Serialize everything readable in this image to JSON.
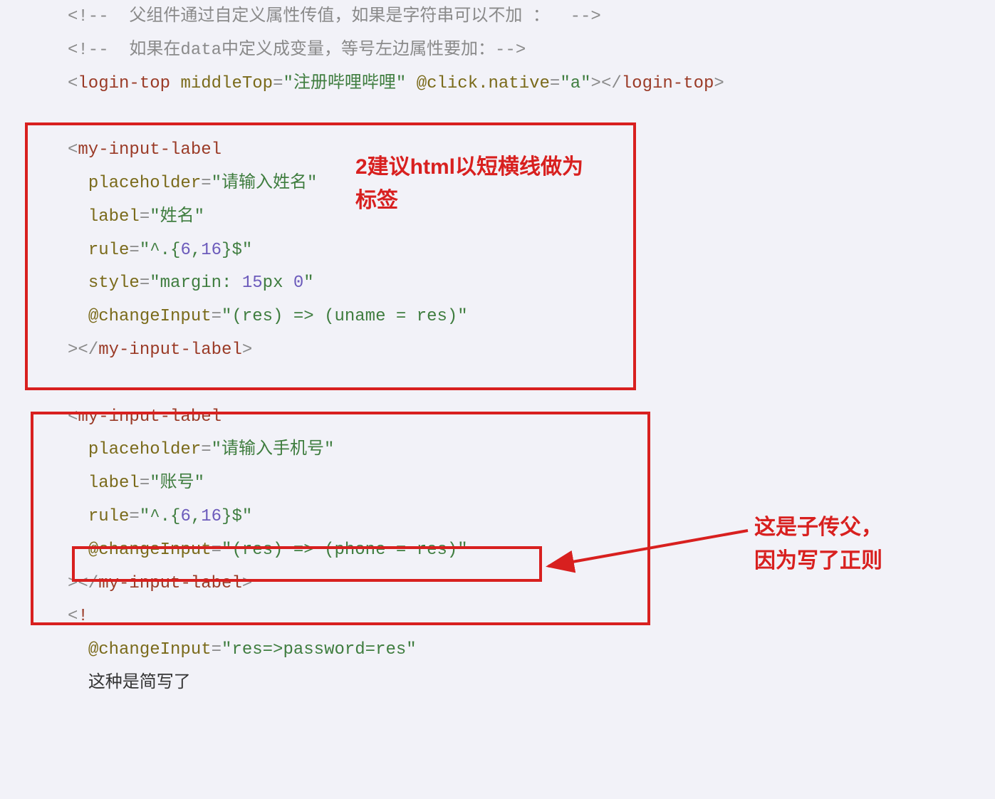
{
  "code": {
    "comment1_open": "<!--",
    "comment1_text": "  父组件通过自定义属性传值，如果是字符串可以不加 ：  ",
    "comment1_close": "-->",
    "comment2_open": "<!--",
    "comment2_text": "  如果在data中定义成变量，等号左边属性要加：",
    "comment2_close": "-->",
    "lt_open_lt": "<",
    "lt_tag": "login-top",
    "lt_attr1": "middleTop",
    "lt_eq": "=",
    "lt_str1": "\"注册哔哩哔哩\"",
    "lt_attr2": "@click.native",
    "lt_str2": "\"a\"",
    "lt_open_gt": ">",
    "lt_close_lt": "</",
    "lt_close_tag": "login-top",
    "lt_close_gt": ">",
    "mi_open_lt": "<",
    "mi_tag": "my-input-label",
    "mi1_attr_ph": "placeholder",
    "mi1_str_ph": "\"请输入姓名\"",
    "mi1_attr_lb": "label",
    "mi1_str_lb": "\"姓名\"",
    "mi1_attr_rule": "rule",
    "mi1_str_rule_q1": "\"^.{",
    "mi1_num1": "6",
    "mi1_str_rule_comma": ",",
    "mi1_num2": "16",
    "mi1_str_rule_q2": "}$\"",
    "mi1_attr_style": "style",
    "mi1_str_style_q1": "\"margin: ",
    "mi1_style_num1": "15",
    "mi1_style_unit": "px ",
    "mi1_style_num2": "0",
    "mi1_str_style_q2": "\"",
    "mi1_attr_ci": "@changeInput",
    "mi1_str_ci": "\"(res) => (uname = res)\"",
    "mi_close_self_gt": ">",
    "mi_close_open": "</",
    "mi_close_tag": "my-input-label",
    "mi_close_gt": ">",
    "mi2_str_ph": "\"请输入手机号\"",
    "mi2_str_lb": "\"账号\"",
    "mi2_str_ci": "\"(res) => (phone = res)\"",
    "frag_lt": "<",
    "frag_bang": "!",
    "mi3_attr_ci": "@changeInput",
    "mi3_str_ci": "\"res=>password=res\"",
    "tail_text": "这种是简写了"
  },
  "annotations": {
    "a1": "2建议html以短横线做为\n标签",
    "a2": "这是子传父，\n因为写了正则"
  }
}
